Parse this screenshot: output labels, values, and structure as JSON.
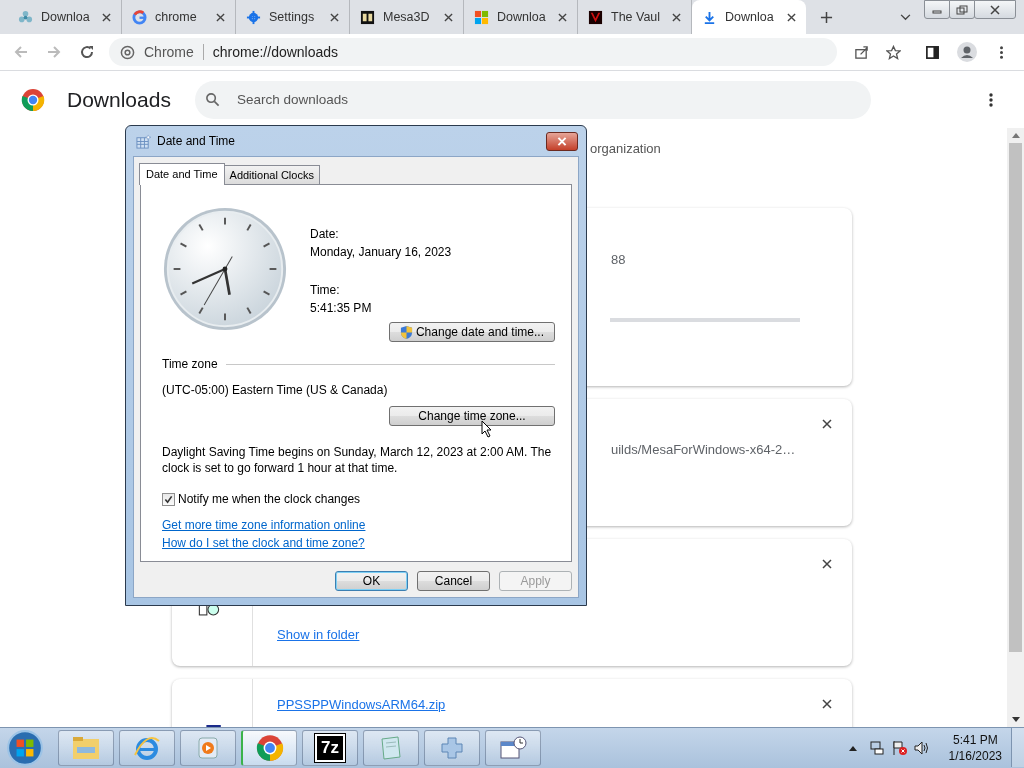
{
  "browser": {
    "tabs": [
      {
        "title": "Downloa",
        "selected": false
      },
      {
        "title": "chrome",
        "selected": false
      },
      {
        "title": "Settings",
        "selected": false
      },
      {
        "title": "Mesa3D",
        "selected": false
      },
      {
        "title": "Downloa",
        "selected": false
      },
      {
        "title": "The Vaul",
        "selected": false
      },
      {
        "title": "Downloa",
        "selected": true
      }
    ],
    "site_label": "Chrome",
    "url": "chrome://downloads"
  },
  "page": {
    "title": "Downloads",
    "search_placeholder": "Search downloads",
    "notice": "organization",
    "downloads": [
      {
        "kind": "progress",
        "detail": "88"
      },
      {
        "kind": "url",
        "detail": "uilds/MesaForWindows-x64-2…"
      },
      {
        "kind": "folder",
        "link": "Show in folder"
      },
      {
        "kind": "file",
        "file_name": "PPSSPPWindowsARM64.zip"
      }
    ]
  },
  "dialog": {
    "title": "Date and Time",
    "tabs": [
      {
        "label": "Date and Time",
        "selected": true
      },
      {
        "label": "Additional Clocks",
        "selected": false
      }
    ],
    "date_label": "Date:",
    "date": "Monday, January 16, 2023",
    "time_label": "Time:",
    "time": "5:41:35 PM",
    "change_date_button": "Change date and time...",
    "time_zone_heading": "Time zone",
    "time_zone": "(UTC-05:00) Eastern Time (US & Canada)",
    "change_time_zone_button": "Change time zone...",
    "dst_text": "Daylight Saving Time begins on Sunday, March 12, 2023 at 2:00 AM. The clock is set to go forward 1 hour at that time.",
    "notify": {
      "label": "Notify me when the clock changes",
      "checked": true
    },
    "links": [
      "Get more time zone information online",
      "How do I set the clock and time zone?"
    ],
    "buttons": [
      {
        "label": "OK",
        "default": true,
        "disabled": false
      },
      {
        "label": "Cancel",
        "default": false,
        "disabled": false
      },
      {
        "label": "Apply",
        "default": false,
        "disabled": true
      }
    ]
  },
  "taskbar": {
    "apps": [
      {
        "kind": "explorer",
        "active": false
      },
      {
        "kind": "ie",
        "active": false
      },
      {
        "kind": "media",
        "active": false
      },
      {
        "kind": "chrome",
        "active": true
      },
      {
        "kind": "archiver",
        "label": "7z",
        "active": false
      },
      {
        "kind": "notepad",
        "active": false
      },
      {
        "kind": "gamepad",
        "active": false
      },
      {
        "kind": "calendar",
        "active": false
      }
    ],
    "time": "5:41 PM",
    "date": "1/16/2023"
  }
}
